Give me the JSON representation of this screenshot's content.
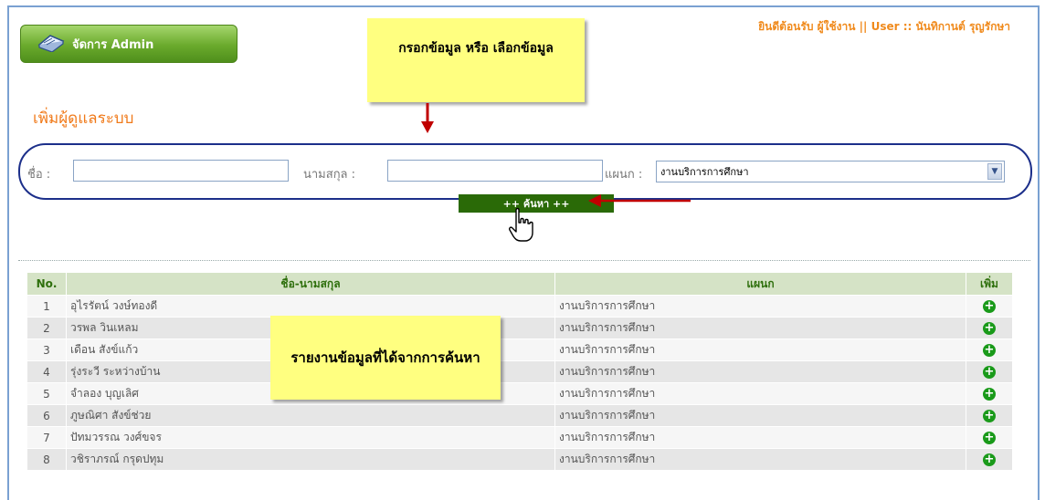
{
  "header": {
    "admin_button_label": "จัดการ Admin",
    "welcome_text": "ยินดีต้อนรับ ผู้ใช้งาน || User :: นันทิกานต์ รุญรักษา"
  },
  "annotations": {
    "note_input": "กรอกข้อมูล หรือ เลือกข้อมูล",
    "note_report": "รายงานข้อมูลที่ได้จากการค้นหา"
  },
  "section_title": "เพิ่มผู้ดูแลระบบ",
  "filter": {
    "first_name_label": "ชื่อ :",
    "first_name_value": "",
    "last_name_label": "นามสกุล :",
    "last_name_value": "",
    "department_label": "แผนก :",
    "department_selected": "งานบริการการศึกษา",
    "search_button_label": "++ ค้นหา ++"
  },
  "table": {
    "headers": [
      "No.",
      "ชื่อ-นามสกุล",
      "แผนก",
      "เพิ่ม"
    ],
    "rows": [
      {
        "no": "1",
        "name": "อุไรรัตน์ วงษ์ทองดี",
        "dept": "งานบริการการศึกษา"
      },
      {
        "no": "2",
        "name": "วรพล วินเหลม",
        "dept": "งานบริการการศึกษา"
      },
      {
        "no": "3",
        "name": "เดือน สังข์แก้ว",
        "dept": "งานบริการการศึกษา"
      },
      {
        "no": "4",
        "name": "รุ่งระวี ระหว่างบ้าน",
        "dept": "งานบริการการศึกษา"
      },
      {
        "no": "5",
        "name": "จำลอง บุญเลิศ",
        "dept": "งานบริการการศึกษา"
      },
      {
        "no": "6",
        "name": "ภูษณิศา สังข์ช่วย",
        "dept": "งานบริการการศึกษา"
      },
      {
        "no": "7",
        "name": "ปัทมวรรณ วงศ์ขจร",
        "dept": "งานบริการการศึกษา"
      },
      {
        "no": "8",
        "name": "วชิราภรณ์ กรุดปทุม",
        "dept": "งานบริการการศึกษา"
      }
    ]
  },
  "colors": {
    "accent_orange": "#f08a1c",
    "header_green": "#2e6f0c",
    "button_green": "#2a6a07",
    "note_yellow": "#ffff80",
    "arrow_red": "#c00000"
  }
}
